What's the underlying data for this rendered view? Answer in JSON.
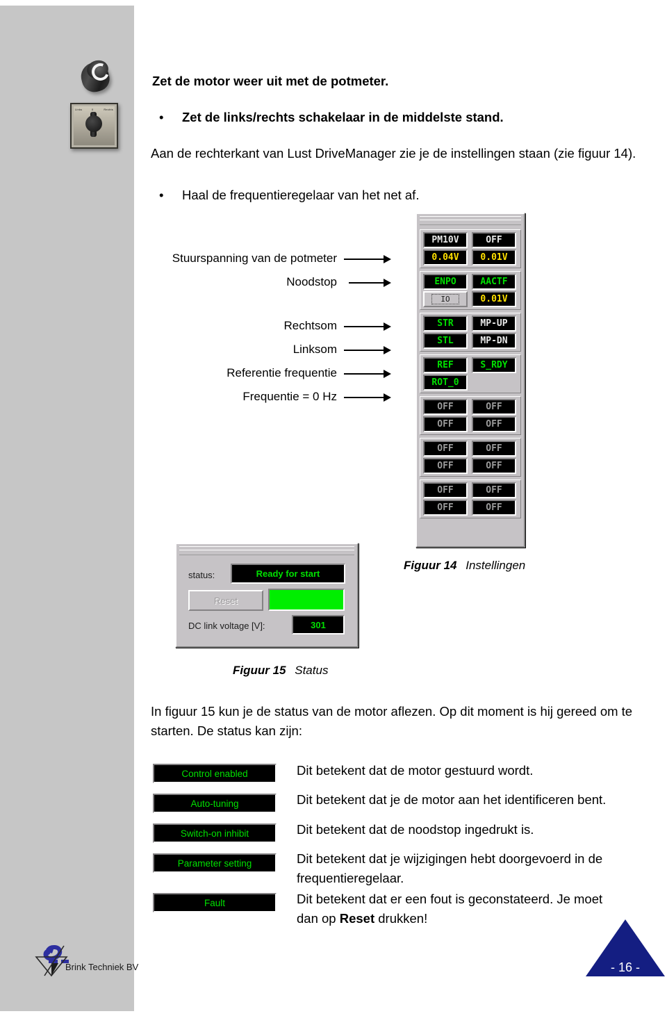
{
  "document": {
    "page_number": "- 16 -",
    "footer_company": "Brink Techniek BV"
  },
  "photos": {
    "knob_caption": "",
    "switch_labels": {
      "left": "Links",
      "center": "0",
      "right": "Rechts"
    }
  },
  "intro": {
    "line1": "Zet de motor weer uit met de potmeter.",
    "bullet1": "Zet de links/rechts schakelaar in de middelste stand.",
    "line2": "Aan de rechterkant van Lust DriveManager zie je de instellingen staan (zie figuur 14).",
    "bullet2": "Haal de frequentieregelaar van het net af.",
    "bullet_glyph": "•"
  },
  "callouts": [
    {
      "label": "Stuurspanning van de potmeter"
    },
    {
      "label": "Noodstop"
    },
    {
      "label": "Rechtsom"
    },
    {
      "label": "Linksom"
    },
    {
      "label": "Referentie frequentie"
    },
    {
      "label": "Frequentie = 0 Hz"
    }
  ],
  "settings_panel": {
    "rows": [
      {
        "left": {
          "text": "PM10V",
          "style": "white"
        },
        "right": {
          "text": "OFF",
          "style": "white"
        }
      },
      {
        "left": {
          "text": "0.04V",
          "style": "yellow"
        },
        "right": {
          "text": "0.01V",
          "style": "yellow"
        }
      },
      {
        "left": {
          "text": "ENPO",
          "style": "green"
        },
        "right": {
          "text": "AACTF",
          "style": "green"
        }
      },
      {
        "left": {
          "text": "IO",
          "style": "button"
        },
        "right": {
          "text": "0.01V",
          "style": "yellow"
        }
      },
      {
        "left": {
          "text": "STR",
          "style": "green"
        },
        "right": {
          "text": "MP-UP",
          "style": "white"
        }
      },
      {
        "left": {
          "text": "STL",
          "style": "green"
        },
        "right": {
          "text": "MP-DN",
          "style": "white"
        }
      },
      {
        "left": {
          "text": "REF",
          "style": "green"
        },
        "right": {
          "text": "S_RDY",
          "style": "green"
        }
      },
      {
        "left": {
          "text": "ROT_0",
          "style": "green"
        },
        "right": {
          "text": "",
          "style": "empty"
        }
      },
      {
        "left": {
          "text": "OFF",
          "style": "gray"
        },
        "right": {
          "text": "OFF",
          "style": "gray"
        }
      },
      {
        "left": {
          "text": "OFF",
          "style": "gray"
        },
        "right": {
          "text": "OFF",
          "style": "gray"
        }
      },
      {
        "left": {
          "text": "OFF",
          "style": "gray"
        },
        "right": {
          "text": "OFF",
          "style": "gray"
        }
      },
      {
        "left": {
          "text": "OFF",
          "style": "gray"
        },
        "right": {
          "text": "OFF",
          "style": "gray"
        }
      },
      {
        "left": {
          "text": "OFF",
          "style": "gray"
        },
        "right": {
          "text": "OFF",
          "style": "gray"
        }
      },
      {
        "left": {
          "text": "OFF",
          "style": "gray"
        },
        "right": {
          "text": "OFF",
          "style": "gray"
        }
      }
    ]
  },
  "status_panel": {
    "status_label": "status:",
    "status_value": "Ready for start",
    "reset_label": "Reset",
    "dc_label": "DC link voltage [V]:",
    "dc_value": "301",
    "bar_color": "#00ee00"
  },
  "figures": {
    "fig14_number": "Figuur 14",
    "fig14_title": "Instellingen",
    "fig15_number": "Figuur 15",
    "fig15_title": "Status"
  },
  "body": {
    "para_line1": "In figuur 15 kun je de status van de motor aflezen. Op dit moment is hij gereed om te",
    "para_line2": "starten. De status kan zijn:"
  },
  "status_list": [
    {
      "button": "Control enabled",
      "desc": "Dit betekent dat de motor gestuurd wordt."
    },
    {
      "button": "Auto-tuning",
      "desc": "Dit betekent dat je de motor aan het identificeren bent."
    },
    {
      "button": "Switch-on inhibit",
      "desc": "Dit betekent dat de noodstop ingedrukt is."
    },
    {
      "button": "Parameter setting",
      "desc_line1": "Dit betekent dat je wijzigingen hebt doorgevoerd in de",
      "desc_line2": "frequentieregelaar."
    },
    {
      "button": "Fault",
      "desc_line1": "Dit betekent dat er een fout is geconstateerd. Je moet",
      "desc_line2_pre": "dan op ",
      "desc_line2_bold": "Reset",
      "desc_line2_post": " drukken!"
    }
  ]
}
